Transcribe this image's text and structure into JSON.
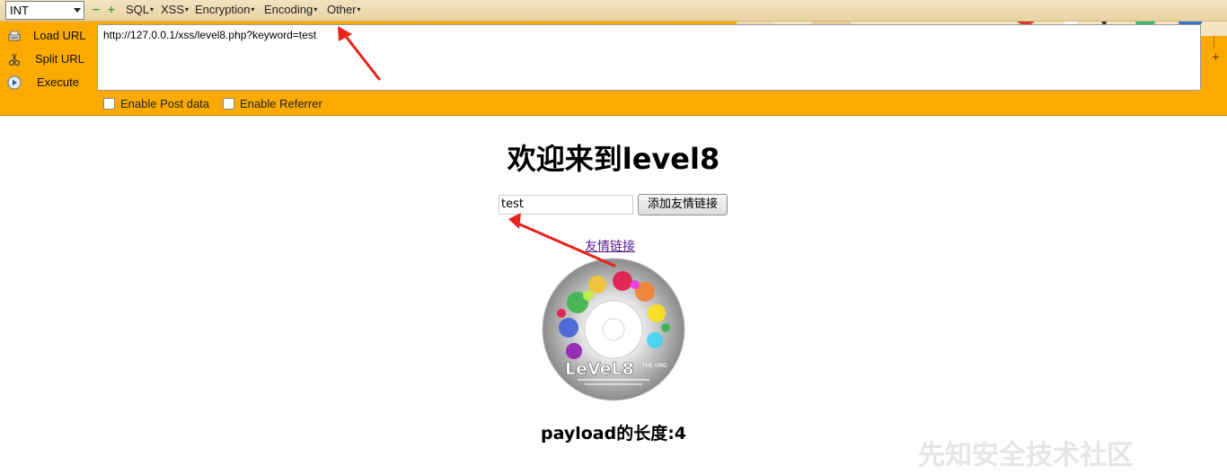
{
  "hackbar": {
    "type_select_value": "INT",
    "zoom_out": "−",
    "zoom_in": "+",
    "menus": [
      {
        "label": "SQL"
      },
      {
        "label": "XSS"
      },
      {
        "label": "Encryption"
      },
      {
        "label": "Encoding"
      },
      {
        "label": "Other"
      }
    ],
    "actions": {
      "load_url": "Load URL",
      "split_url": "Split URL",
      "execute": "Execute"
    },
    "url_value": "http://127.0.0.1/xss/level8.php?keyword=test",
    "checkboxes": {
      "post_data": "Enable Post data",
      "referrer": "Enable Referrer"
    },
    "plus_label": "+"
  },
  "page": {
    "title": "欢迎来到level8",
    "keyword_value": "test",
    "add_link_button": "添加友情链接",
    "friend_link": "友情链接",
    "disc_logo_text": "LeVeL8",
    "disc_logo_sub": "THE ONG",
    "payload_length": "payload的长度:4"
  },
  "watermark": "先知安全技术社区",
  "colors": {
    "toolbar_orange": "#fbab00",
    "annotation_red": "#e8231b",
    "link_purple": "#551a8b"
  }
}
